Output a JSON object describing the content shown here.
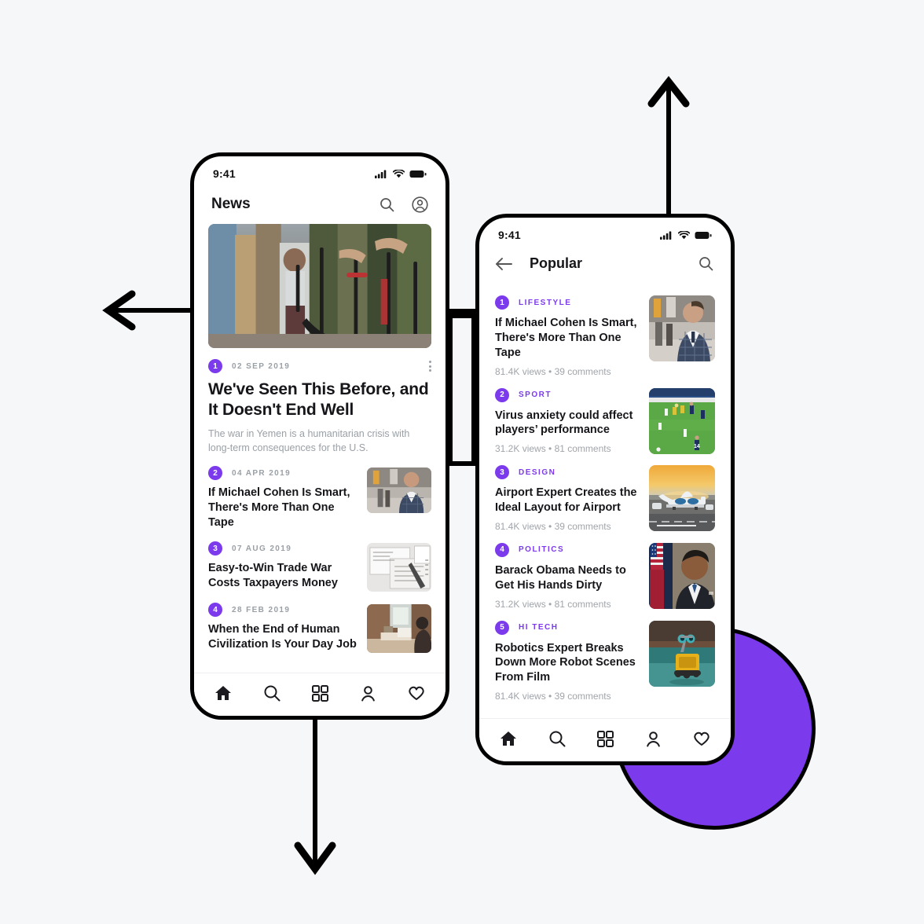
{
  "canvas": {
    "background": "#f6f7f9",
    "accent": "#7c3aed",
    "outline": "#000000"
  },
  "decor": {
    "circle_color": "#7c3aed",
    "arrow_up_label": "arrow-up",
    "arrow_left_label": "arrow-left",
    "arrow_down_label": "arrow-down",
    "bracket_label": "connector-bracket"
  },
  "phone_news": {
    "status": {
      "time": "9:41",
      "signal": "signal-icon",
      "wifi": "wifi-icon",
      "battery": "battery-icon"
    },
    "header": {
      "title": "News",
      "search_icon": "search-icon",
      "account_icon": "account-circle-icon"
    },
    "hero": {
      "alt": "Armed crowd with child holding rifle"
    },
    "lead": {
      "rank": "1",
      "date": "02 SEP 2019",
      "title": "We've Seen This Before, and It Doesn't End Well",
      "summary": "The war in Yemen is a humanitarian crisis with long-term consequences for the U.S.",
      "menu_icon": "more-vertical-icon"
    },
    "items": [
      {
        "rank": "2",
        "date": "04 APR 2019",
        "title": "If Michael Cohen Is Smart, There's More Than One Tape",
        "thumb": "man-in-checked-suit"
      },
      {
        "rank": "3",
        "date": "07 AUG 2019",
        "title": "Easy-to-Win Trade War Costs Taxpayers Money",
        "thumb": "tax-documents-on-desk"
      },
      {
        "rank": "4",
        "date": "28 FEB 2019",
        "title": "When the End of Human Civilization Is Your Day Job",
        "thumb": "man-working-at-desk"
      }
    ],
    "nav": [
      {
        "icon": "home-icon",
        "label": "Home",
        "active": true
      },
      {
        "icon": "search-icon",
        "label": "Search",
        "active": false
      },
      {
        "icon": "grid-icon",
        "label": "Categories",
        "active": false
      },
      {
        "icon": "person-icon",
        "label": "Profile",
        "active": false
      },
      {
        "icon": "heart-icon",
        "label": "Favorites",
        "active": false
      }
    ]
  },
  "phone_popular": {
    "status": {
      "time": "9:41",
      "signal": "signal-icon",
      "wifi": "wifi-icon",
      "battery": "battery-icon"
    },
    "header": {
      "back_icon": "arrow-left-icon",
      "title": "Popular",
      "search_icon": "search-icon"
    },
    "items": [
      {
        "rank": "1",
        "category": "LIFESTYLE",
        "title": "If Michael Cohen Is Smart, There's More Than One Tape",
        "stats": "81.4K views • 39 comments",
        "thumb": "man-in-checked-suit"
      },
      {
        "rank": "2",
        "category": "SPORT",
        "title": "Virus anxiety could affect players’ performance",
        "stats": "31.2K views • 81 comments",
        "thumb": "soccer-match-on-pitch"
      },
      {
        "rank": "3",
        "category": "DESIGN",
        "title": "Airport Expert Creates the Ideal Layout for Airport",
        "stats": "81.4K views • 39 comments",
        "thumb": "airplane-at-sunset"
      },
      {
        "rank": "4",
        "category": "POLITICS",
        "title": "Barack Obama Needs to Get His Hands Dirty",
        "stats": "31.2K views • 81 comments",
        "thumb": "portrait-with-flag"
      },
      {
        "rank": "5",
        "category": "HI TECH",
        "title": "Robotics Expert Breaks Down More Robot Scenes From Film",
        "stats": "81.4K views • 39 comments",
        "thumb": "yellow-toy-robot"
      }
    ],
    "nav": [
      {
        "icon": "home-icon",
        "label": "Home",
        "active": true
      },
      {
        "icon": "search-icon",
        "label": "Search",
        "active": false
      },
      {
        "icon": "grid-icon",
        "label": "Categories",
        "active": false
      },
      {
        "icon": "person-icon",
        "label": "Profile",
        "active": false
      },
      {
        "icon": "heart-icon",
        "label": "Favorites",
        "active": false
      }
    ]
  }
}
